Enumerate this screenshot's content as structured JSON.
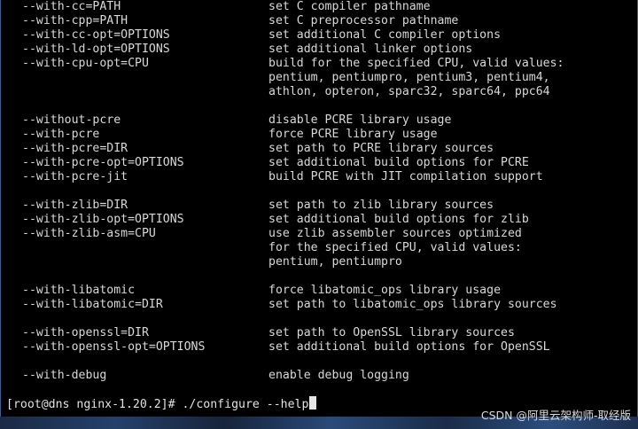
{
  "options": [
    {
      "opt": "--with-cc=PATH",
      "desc": "set C compiler pathname"
    },
    {
      "opt": "--with-cpp=PATH",
      "desc": "set C preprocessor pathname"
    },
    {
      "opt": "--with-cc-opt=OPTIONS",
      "desc": "set additional C compiler options"
    },
    {
      "opt": "--with-ld-opt=OPTIONS",
      "desc": "set additional linker options"
    },
    {
      "opt": "--with-cpu-opt=CPU",
      "desc": "build for the specified CPU, valid values:"
    },
    {
      "opt": "",
      "desc": "pentium, pentiumpro, pentium3, pentium4,"
    },
    {
      "opt": "",
      "desc": "athlon, opteron, sparc32, sparc64, ppc64"
    },
    {
      "opt": "",
      "desc": ""
    },
    {
      "opt": "--without-pcre",
      "desc": "disable PCRE library usage"
    },
    {
      "opt": "--with-pcre",
      "desc": "force PCRE library usage"
    },
    {
      "opt": "--with-pcre=DIR",
      "desc": "set path to PCRE library sources"
    },
    {
      "opt": "--with-pcre-opt=OPTIONS",
      "desc": "set additional build options for PCRE"
    },
    {
      "opt": "--with-pcre-jit",
      "desc": "build PCRE with JIT compilation support"
    },
    {
      "opt": "",
      "desc": ""
    },
    {
      "opt": "--with-zlib=DIR",
      "desc": "set path to zlib library sources"
    },
    {
      "opt": "--with-zlib-opt=OPTIONS",
      "desc": "set additional build options for zlib"
    },
    {
      "opt": "--with-zlib-asm=CPU",
      "desc": "use zlib assembler sources optimized"
    },
    {
      "opt": "",
      "desc": "for the specified CPU, valid values:"
    },
    {
      "opt": "",
      "desc": "pentium, pentiumpro"
    },
    {
      "opt": "",
      "desc": ""
    },
    {
      "opt": "--with-libatomic",
      "desc": "force libatomic_ops library usage"
    },
    {
      "opt": "--with-libatomic=DIR",
      "desc": "set path to libatomic_ops library sources"
    },
    {
      "opt": "",
      "desc": ""
    },
    {
      "opt": "--with-openssl=DIR",
      "desc": "set path to OpenSSL library sources"
    },
    {
      "opt": "--with-openssl-opt=OPTIONS",
      "desc": "set additional build options for OpenSSL"
    },
    {
      "opt": "",
      "desc": ""
    },
    {
      "opt": "--with-debug",
      "desc": "enable debug logging"
    }
  ],
  "prompt": {
    "text": "[root@dns nginx-1.20.2]# ./configure --help"
  },
  "watermark": "CSDN @阿里云架构师-取经版",
  "colors": {
    "background": "#000000",
    "text": "#d8d8d8",
    "frame": "#3b5f8f"
  }
}
